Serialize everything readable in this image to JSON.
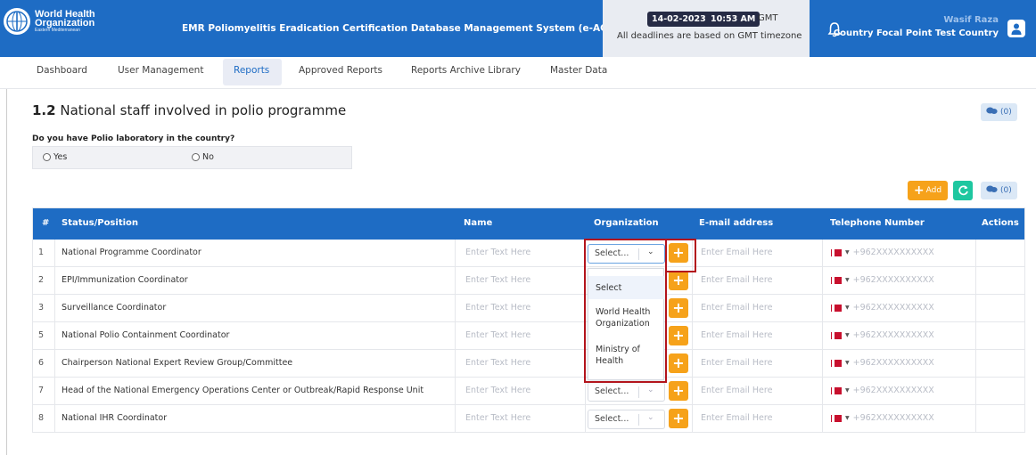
{
  "header": {
    "logo": {
      "line1": "World Health",
      "line2": "Organization",
      "line3": "Eastern Mediterranean"
    },
    "app_title": "EMR Poliomyelitis Eradication Certification Database Management System (e-ACR)",
    "date": "14-02-2023",
    "time": "10:53 AM",
    "tz": "GMT",
    "deadline_note": "All deadlines are based on GMT timezone",
    "user_name": "Wasif Raza",
    "user_role": "Country Focal Point Test Country"
  },
  "nav": {
    "items": [
      "Dashboard",
      "User Management",
      "Reports",
      "Approved Reports",
      "Reports Archive Library",
      "Master Data"
    ],
    "active": "Reports"
  },
  "section": {
    "title_num": "1.2",
    "title_text": "National staff involved in polio programme",
    "comment_count": "(0)",
    "question": "Do you have Polio laboratory in the country?",
    "options": [
      "Yes",
      "No"
    ],
    "add_label": "Add",
    "table_comment_count": "(0)"
  },
  "table": {
    "headers": [
      "#",
      "Status/Position",
      "Name",
      "Organization",
      "E-mail address",
      "Telephone Number",
      "Actions"
    ],
    "name_placeholder": "Enter Text Here",
    "email_placeholder": "Enter Email Here",
    "phone_placeholder": "+962XXXXXXXXXX",
    "select_placeholder": "Select...",
    "rows": [
      {
        "num": "1",
        "status": "National Programme Coordinator"
      },
      {
        "num": "2",
        "status": "EPI/Immunization Coordinator"
      },
      {
        "num": "3",
        "status": "Surveillance Coordinator"
      },
      {
        "num": "5",
        "status": "National Polio Containment Coordinator"
      },
      {
        "num": "6",
        "status": "Chairperson National Expert Review Group/Committee"
      },
      {
        "num": "7",
        "status": "Head of the National Emergency Operations Center or Outbreak/Rapid Response Unit"
      },
      {
        "num": "8",
        "status": "National IHR Coordinator"
      }
    ]
  },
  "dropdown": {
    "options": [
      "Select",
      "World Health Organization",
      "Ministry of Health"
    ]
  },
  "colors": {
    "primary": "#1e6cc4",
    "accent": "#f6a21a",
    "refresh": "#1ec7a0",
    "highlight": "#b3141c"
  }
}
